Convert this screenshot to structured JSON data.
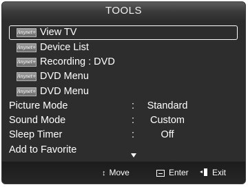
{
  "title": "TOOLS",
  "menu": {
    "anynet_items": [
      {
        "badge": "Anynet+",
        "label": "View TV"
      },
      {
        "badge": "Anynet+",
        "label": "Device List"
      },
      {
        "badge": "Anynet+",
        "label": "Recording : DVD"
      },
      {
        "badge": "Anynet+",
        "label": "DVD Menu"
      },
      {
        "badge": "Anynet+",
        "label": "DVD Menu"
      }
    ],
    "settings": [
      {
        "label": "Picture Mode",
        "separator": ":",
        "value": "Standard"
      },
      {
        "label": "Sound Mode",
        "separator": ":",
        "value": "Custom"
      },
      {
        "label": "Sleep Timer",
        "separator": ":",
        "value": "Off"
      }
    ],
    "extra_item": "Add to Favorite",
    "selected_index": 0
  },
  "footer": {
    "move": {
      "icon": "updown-arrow-icon",
      "glyph": "↕",
      "label": "Move"
    },
    "enter": {
      "icon": "enter-icon",
      "label": "Enter"
    },
    "exit": {
      "icon": "exit-icon",
      "label": "Exit"
    }
  }
}
